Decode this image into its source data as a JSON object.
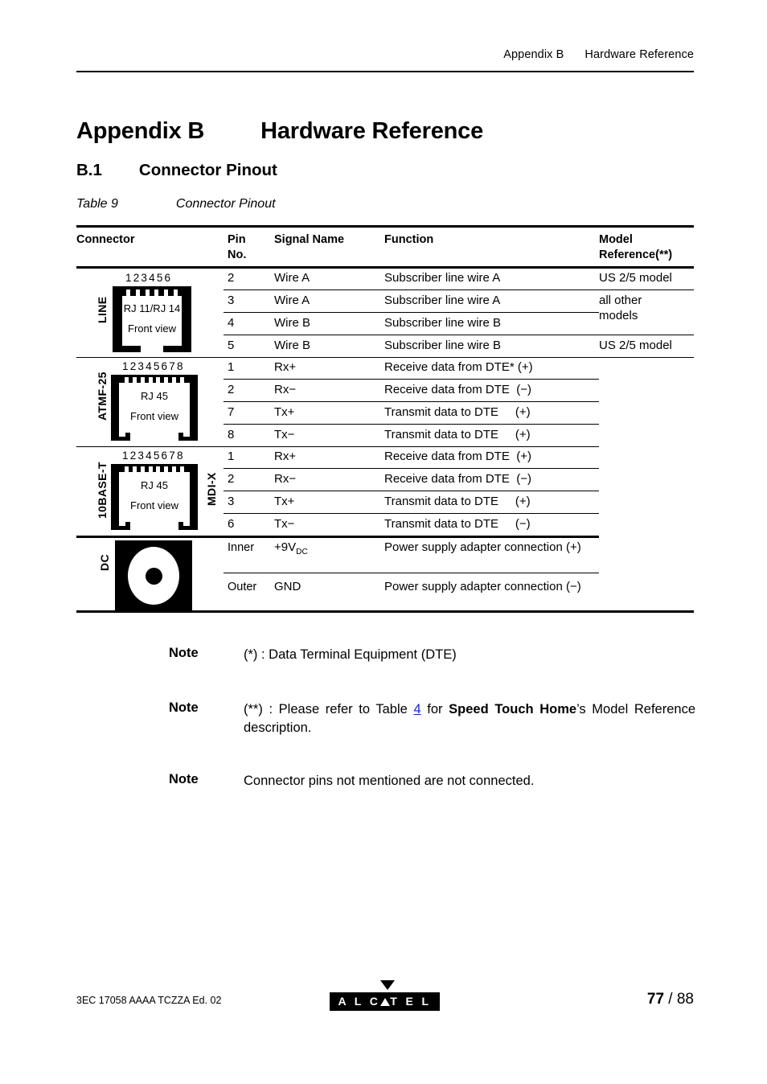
{
  "header": {
    "appendix": "Appendix B",
    "title": "Hardware Reference"
  },
  "appendix_title": {
    "number": "Appendix B",
    "name": "Hardware Reference"
  },
  "section": {
    "number": "B.1",
    "name": "Connector Pinout"
  },
  "caption": {
    "label": "Table 9",
    "text": "Connector Pinout"
  },
  "table": {
    "columns": {
      "connector": "Connector",
      "pin_no_line1": "Pin",
      "pin_no_line2": "No.",
      "signal_name": "Signal Name",
      "function": "Function",
      "model_ref_line1": "Model",
      "model_ref_line2": "Reference(**)"
    },
    "groups": [
      {
        "side_label": "LINE",
        "connector": {
          "type": "rj11-rj14-jack",
          "pin_numbers": "123456",
          "name": "RJ 11/RJ 14",
          "view": "Front view",
          "pin_count": 6
        },
        "rows": [
          {
            "pin": "2",
            "signal": "Wire A",
            "function": "Subscriber line wire A",
            "model": "US 2/5 model"
          },
          {
            "pin": "3",
            "signal": "Wire A",
            "function": "Subscriber line wire A",
            "model": "all other"
          },
          {
            "pin": "4",
            "signal": "Wire B",
            "function": "Subscriber line wire B",
            "model": "models"
          },
          {
            "pin": "5",
            "signal": "Wire B",
            "function": "Subscriber line wire B",
            "model": "US 2/5 model"
          }
        ]
      },
      {
        "side_label": "ATMF-25",
        "connector": {
          "type": "rj45-jack",
          "pin_numbers": "12345678",
          "name": "RJ 45",
          "view": "Front view",
          "pin_count": 8
        },
        "rows": [
          {
            "pin": "1",
            "signal": "Rx+",
            "function": "Receive data from DTE* (+)",
            "model": ""
          },
          {
            "pin": "2",
            "signal": "Rx−",
            "function": "Receive data from DTE  (−)",
            "model": ""
          },
          {
            "pin": "7",
            "signal": "Tx+",
            "function": "Transmit data to DTE     (+)",
            "model": ""
          },
          {
            "pin": "8",
            "signal": "Tx−",
            "function": "Transmit data to DTE     (+)",
            "model": ""
          }
        ]
      },
      {
        "side_label": "10BASE-T",
        "side_label_right": "MDI-X",
        "connector": {
          "type": "rj45-jack",
          "pin_numbers": "12345678",
          "name": "RJ 45",
          "view": "Front view",
          "pin_count": 8
        },
        "rows": [
          {
            "pin": "1",
            "signal": "Rx+",
            "function": "Receive data from DTE  (+)",
            "model": ""
          },
          {
            "pin": "2",
            "signal": "Rx−",
            "function": "Receive data from DTE  (−)",
            "model": ""
          },
          {
            "pin": "3",
            "signal": "Tx+",
            "function": "Transmit data to DTE     (+)",
            "model": ""
          },
          {
            "pin": "6",
            "signal": "Tx−",
            "function": "Transmit data to DTE     (−)",
            "model": ""
          }
        ]
      },
      {
        "side_label": "DC",
        "connector": {
          "type": "dc-barrel-jack"
        },
        "rows": [
          {
            "pin": "Inner",
            "signal": "+9V",
            "signal_sub": "DC",
            "function": "Power supply adapter connection (+)",
            "model": ""
          },
          {
            "pin": "Outer",
            "signal": "GND",
            "signal_sub": "",
            "function": "Power supply adapter connection (−)",
            "model": ""
          }
        ]
      }
    ]
  },
  "notes": [
    {
      "label": "Note",
      "text": "(*) : Data Terminal Equipment (DTE)"
    },
    {
      "label": "Note",
      "prefix": "(**) : Please refer to Table ",
      "link": "4",
      "middle": " for ",
      "bold": "Speed Touch  Home",
      "suffix": "’s Model Reference description."
    },
    {
      "label": "Note",
      "text": "Connector pins not mentioned are not connected."
    }
  ],
  "footer": {
    "doc_code": "3EC 17058 AAAA TCZZA Ed. 02",
    "logo_text_a": "A L C",
    "logo_text_b": "T E L",
    "page_current": "77",
    "page_sep": " / ",
    "page_total": "88"
  },
  "colors": {
    "ink": "#000000",
    "paper": "#ffffff",
    "link": "#1a23d8"
  }
}
